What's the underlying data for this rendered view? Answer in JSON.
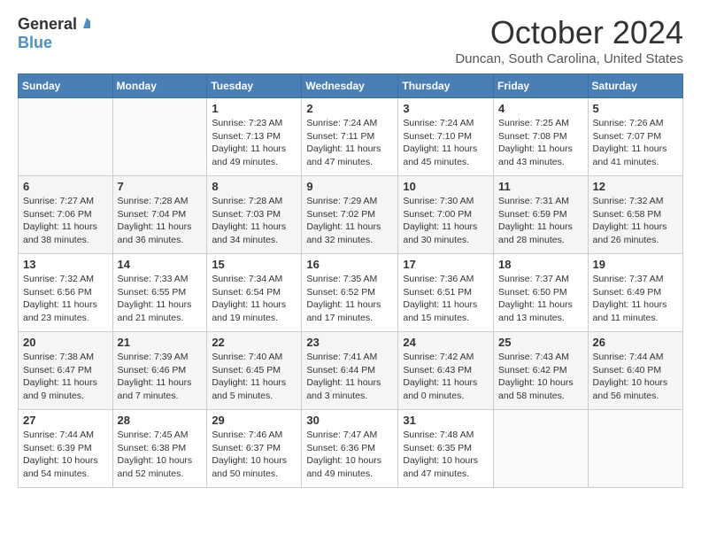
{
  "header": {
    "logo_general": "General",
    "logo_blue": "Blue",
    "month_title": "October 2024",
    "location": "Duncan, South Carolina, United States"
  },
  "weekdays": [
    "Sunday",
    "Monday",
    "Tuesday",
    "Wednesday",
    "Thursday",
    "Friday",
    "Saturday"
  ],
  "weeks": [
    [
      {
        "day": "",
        "info": ""
      },
      {
        "day": "",
        "info": ""
      },
      {
        "day": "1",
        "info": "Sunrise: 7:23 AM\nSunset: 7:13 PM\nDaylight: 11 hours and 49 minutes."
      },
      {
        "day": "2",
        "info": "Sunrise: 7:24 AM\nSunset: 7:11 PM\nDaylight: 11 hours and 47 minutes."
      },
      {
        "day": "3",
        "info": "Sunrise: 7:24 AM\nSunset: 7:10 PM\nDaylight: 11 hours and 45 minutes."
      },
      {
        "day": "4",
        "info": "Sunrise: 7:25 AM\nSunset: 7:08 PM\nDaylight: 11 hours and 43 minutes."
      },
      {
        "day": "5",
        "info": "Sunrise: 7:26 AM\nSunset: 7:07 PM\nDaylight: 11 hours and 41 minutes."
      }
    ],
    [
      {
        "day": "6",
        "info": "Sunrise: 7:27 AM\nSunset: 7:06 PM\nDaylight: 11 hours and 38 minutes."
      },
      {
        "day": "7",
        "info": "Sunrise: 7:28 AM\nSunset: 7:04 PM\nDaylight: 11 hours and 36 minutes."
      },
      {
        "day": "8",
        "info": "Sunrise: 7:28 AM\nSunset: 7:03 PM\nDaylight: 11 hours and 34 minutes."
      },
      {
        "day": "9",
        "info": "Sunrise: 7:29 AM\nSunset: 7:02 PM\nDaylight: 11 hours and 32 minutes."
      },
      {
        "day": "10",
        "info": "Sunrise: 7:30 AM\nSunset: 7:00 PM\nDaylight: 11 hours and 30 minutes."
      },
      {
        "day": "11",
        "info": "Sunrise: 7:31 AM\nSunset: 6:59 PM\nDaylight: 11 hours and 28 minutes."
      },
      {
        "day": "12",
        "info": "Sunrise: 7:32 AM\nSunset: 6:58 PM\nDaylight: 11 hours and 26 minutes."
      }
    ],
    [
      {
        "day": "13",
        "info": "Sunrise: 7:32 AM\nSunset: 6:56 PM\nDaylight: 11 hours and 23 minutes."
      },
      {
        "day": "14",
        "info": "Sunrise: 7:33 AM\nSunset: 6:55 PM\nDaylight: 11 hours and 21 minutes."
      },
      {
        "day": "15",
        "info": "Sunrise: 7:34 AM\nSunset: 6:54 PM\nDaylight: 11 hours and 19 minutes."
      },
      {
        "day": "16",
        "info": "Sunrise: 7:35 AM\nSunset: 6:52 PM\nDaylight: 11 hours and 17 minutes."
      },
      {
        "day": "17",
        "info": "Sunrise: 7:36 AM\nSunset: 6:51 PM\nDaylight: 11 hours and 15 minutes."
      },
      {
        "day": "18",
        "info": "Sunrise: 7:37 AM\nSunset: 6:50 PM\nDaylight: 11 hours and 13 minutes."
      },
      {
        "day": "19",
        "info": "Sunrise: 7:37 AM\nSunset: 6:49 PM\nDaylight: 11 hours and 11 minutes."
      }
    ],
    [
      {
        "day": "20",
        "info": "Sunrise: 7:38 AM\nSunset: 6:47 PM\nDaylight: 11 hours and 9 minutes."
      },
      {
        "day": "21",
        "info": "Sunrise: 7:39 AM\nSunset: 6:46 PM\nDaylight: 11 hours and 7 minutes."
      },
      {
        "day": "22",
        "info": "Sunrise: 7:40 AM\nSunset: 6:45 PM\nDaylight: 11 hours and 5 minutes."
      },
      {
        "day": "23",
        "info": "Sunrise: 7:41 AM\nSunset: 6:44 PM\nDaylight: 11 hours and 3 minutes."
      },
      {
        "day": "24",
        "info": "Sunrise: 7:42 AM\nSunset: 6:43 PM\nDaylight: 11 hours and 0 minutes."
      },
      {
        "day": "25",
        "info": "Sunrise: 7:43 AM\nSunset: 6:42 PM\nDaylight: 10 hours and 58 minutes."
      },
      {
        "day": "26",
        "info": "Sunrise: 7:44 AM\nSunset: 6:40 PM\nDaylight: 10 hours and 56 minutes."
      }
    ],
    [
      {
        "day": "27",
        "info": "Sunrise: 7:44 AM\nSunset: 6:39 PM\nDaylight: 10 hours and 54 minutes."
      },
      {
        "day": "28",
        "info": "Sunrise: 7:45 AM\nSunset: 6:38 PM\nDaylight: 10 hours and 52 minutes."
      },
      {
        "day": "29",
        "info": "Sunrise: 7:46 AM\nSunset: 6:37 PM\nDaylight: 10 hours and 50 minutes."
      },
      {
        "day": "30",
        "info": "Sunrise: 7:47 AM\nSunset: 6:36 PM\nDaylight: 10 hours and 49 minutes."
      },
      {
        "day": "31",
        "info": "Sunrise: 7:48 AM\nSunset: 6:35 PM\nDaylight: 10 hours and 47 minutes."
      },
      {
        "day": "",
        "info": ""
      },
      {
        "day": "",
        "info": ""
      }
    ]
  ]
}
